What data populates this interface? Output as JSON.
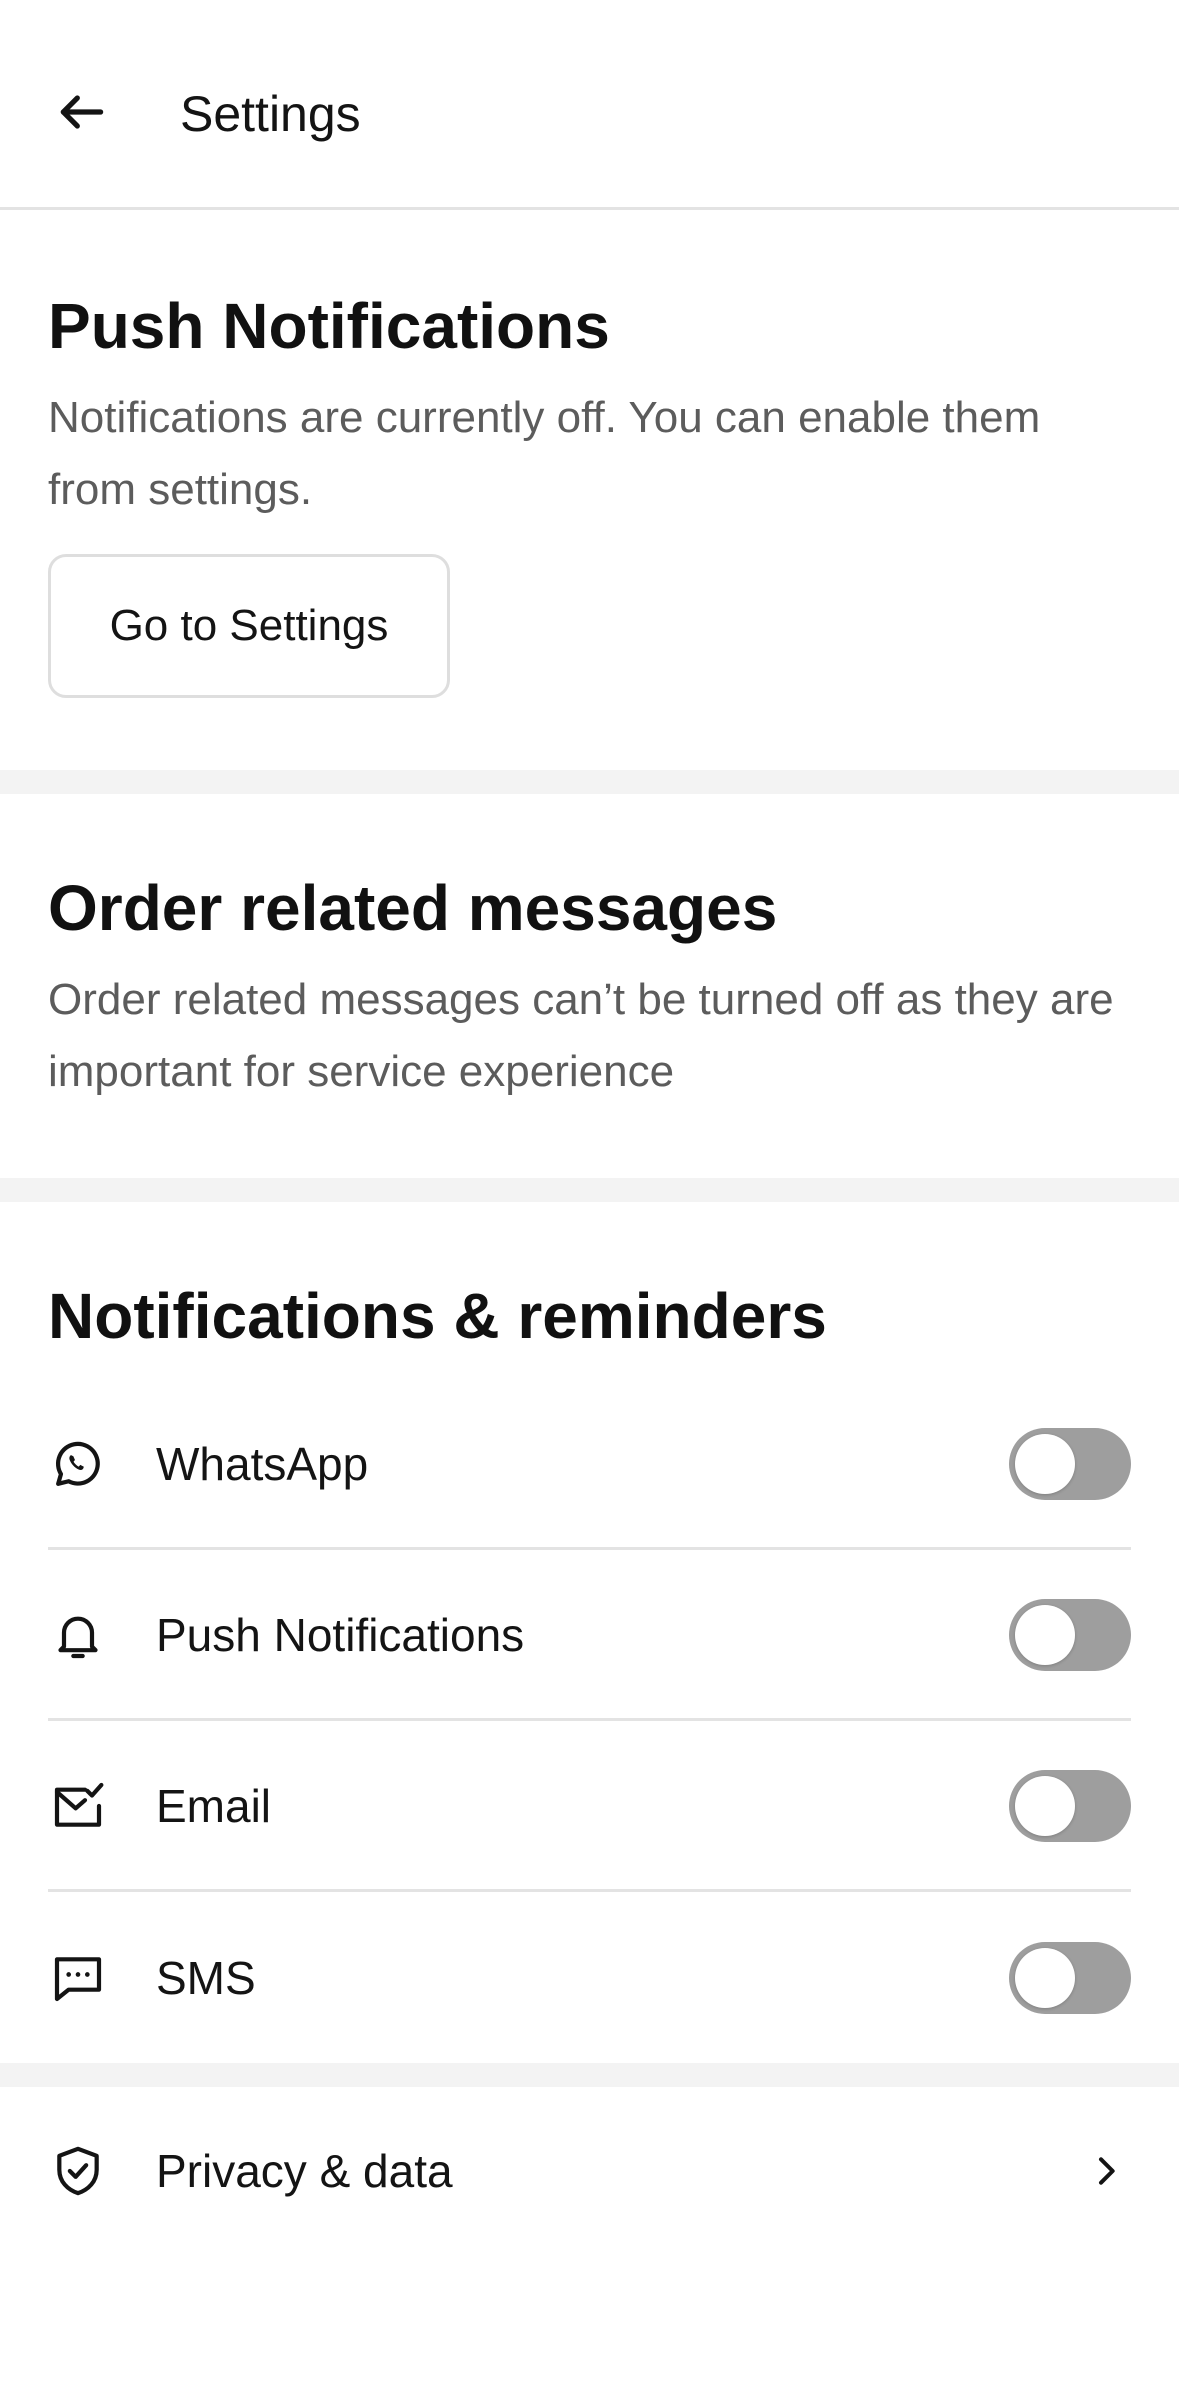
{
  "header": {
    "title": "Settings",
    "back_icon": "arrow-left-icon"
  },
  "push_section": {
    "title": "Push Notifications",
    "description": "Notifications are currently off. You can enable them from settings.",
    "button_label": "Go to Settings"
  },
  "order_section": {
    "title": "Order related messages",
    "description": "Order related messages can’t be turned off as they are important for service experience"
  },
  "reminders_section": {
    "title": "Notifications & reminders",
    "items": [
      {
        "label": "WhatsApp",
        "icon": "whatsapp-icon",
        "enabled": false
      },
      {
        "label": "Push Notifications",
        "icon": "bell-icon",
        "enabled": false
      },
      {
        "label": "Email",
        "icon": "mail-check-icon",
        "enabled": false
      },
      {
        "label": "SMS",
        "icon": "message-dots-icon",
        "enabled": false
      }
    ]
  },
  "privacy": {
    "label": "Privacy & data",
    "icon": "shield-check-icon"
  },
  "colors": {
    "toggle_off": "#9e9e9e",
    "text_primary": "#141414",
    "text_secondary": "#5c5c5c",
    "divider": "#e3e3e3",
    "band": "#f3f3f3"
  }
}
